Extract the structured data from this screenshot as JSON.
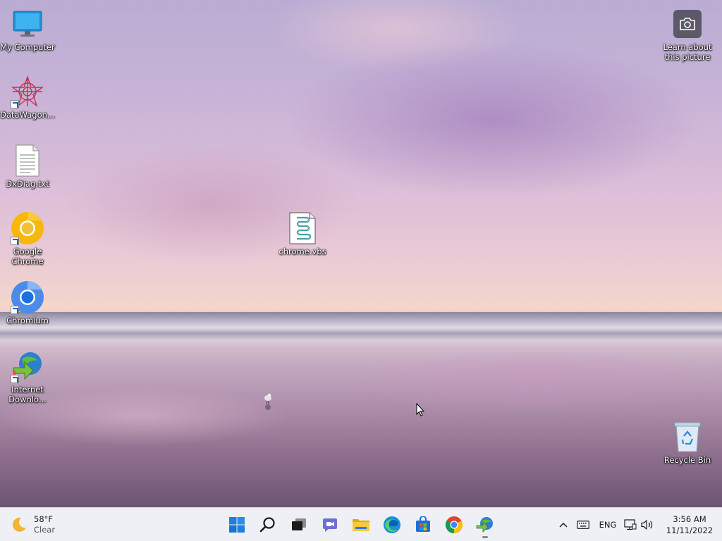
{
  "desktop_icons": [
    {
      "label": "My Computer",
      "icon": "monitor-icon",
      "shortcut": false
    },
    {
      "label": "DataWagon...",
      "icon": "datawagon-icon",
      "shortcut": true
    },
    {
      "label": "DxDiag.txt",
      "icon": "text-file-icon",
      "shortcut": false
    },
    {
      "label": "Google Chrome",
      "icon": "chrome-icon",
      "shortcut": true
    },
    {
      "label": "Chromium",
      "icon": "chromium-icon",
      "shortcut": true
    },
    {
      "label": "Internet Downlo...",
      "icon": "idm-icon",
      "shortcut": true
    },
    {
      "label": "chrome.vbs",
      "icon": "script-file-icon",
      "shortcut": false
    },
    {
      "label": "Recycle Bin",
      "icon": "recycle-bin-icon",
      "shortcut": false
    }
  ],
  "learn_about": {
    "label_line1": "Learn about",
    "label_line2": "this picture",
    "icon": "camera-icon"
  },
  "taskbar": {
    "weather": {
      "temp": "58°F",
      "condition": "Clear",
      "icon": "moon-icon"
    },
    "apps": [
      {
        "name": "Start",
        "icon": "windows-start-icon"
      },
      {
        "name": "Search",
        "icon": "search-icon"
      },
      {
        "name": "Task View",
        "icon": "task-view-icon"
      },
      {
        "name": "Chat",
        "icon": "chat-icon"
      },
      {
        "name": "File Explorer",
        "icon": "folder-icon"
      },
      {
        "name": "Microsoft Edge",
        "icon": "edge-icon"
      },
      {
        "name": "Microsoft Store",
        "icon": "store-icon"
      },
      {
        "name": "Google Chrome",
        "icon": "chrome-icon"
      },
      {
        "name": "Internet Download Manager",
        "icon": "idm-icon"
      }
    ],
    "tray": {
      "language": "ENG"
    },
    "clock": {
      "time": "3:56 AM",
      "date": "11/11/2022"
    }
  },
  "colors": {
    "taskbar_bg": "#eef0f5",
    "start_blue": "#0a6cd6"
  }
}
